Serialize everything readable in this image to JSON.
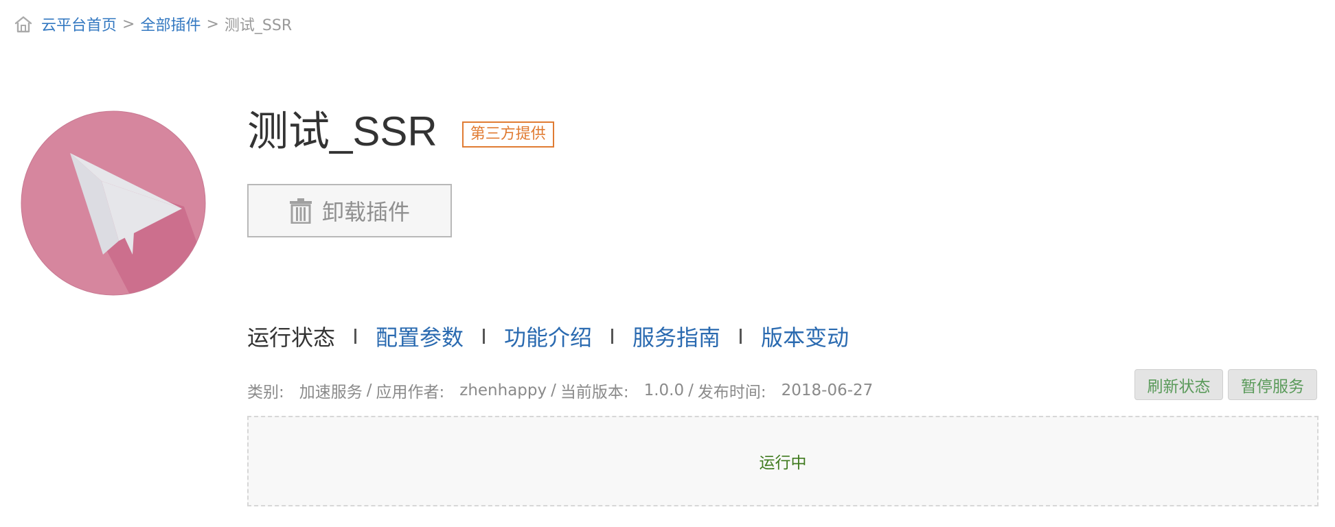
{
  "breadcrumb": {
    "home_icon": "home-icon",
    "home": "云平台首页",
    "all_plugins": "全部插件",
    "current": "测试_SSR",
    "separator": ">"
  },
  "plugin": {
    "name": "测试_SSR",
    "badge": "第三方提供",
    "logo_icon": "paper-plane-logo",
    "logo_color": "#d6869e"
  },
  "uninstall_button": {
    "icon": "trash-icon",
    "label": "卸载插件"
  },
  "tabs": [
    {
      "label": "运行状态",
      "active": true
    },
    {
      "label": "配置参数",
      "active": false
    },
    {
      "label": "功能介绍",
      "active": false
    },
    {
      "label": "服务指南",
      "active": false
    },
    {
      "label": "版本变动",
      "active": false
    }
  ],
  "meta": {
    "category_label": "类别:",
    "category_value": "加速服务",
    "author_label": "应用作者:",
    "author_value": "zhenhappy",
    "version_label": "当前版本:",
    "version_value": "1.0.0",
    "release_label": "发布时间:",
    "release_value": "2018-06-27",
    "separator": "/"
  },
  "actions": {
    "refresh": "刷新状态",
    "pause": "暂停服务"
  },
  "status": {
    "text": "运行中",
    "color": "#3f7a1e"
  },
  "colors": {
    "link": "#3378c1",
    "tab_link": "#2a6ab0",
    "badge": "#e07b32"
  }
}
